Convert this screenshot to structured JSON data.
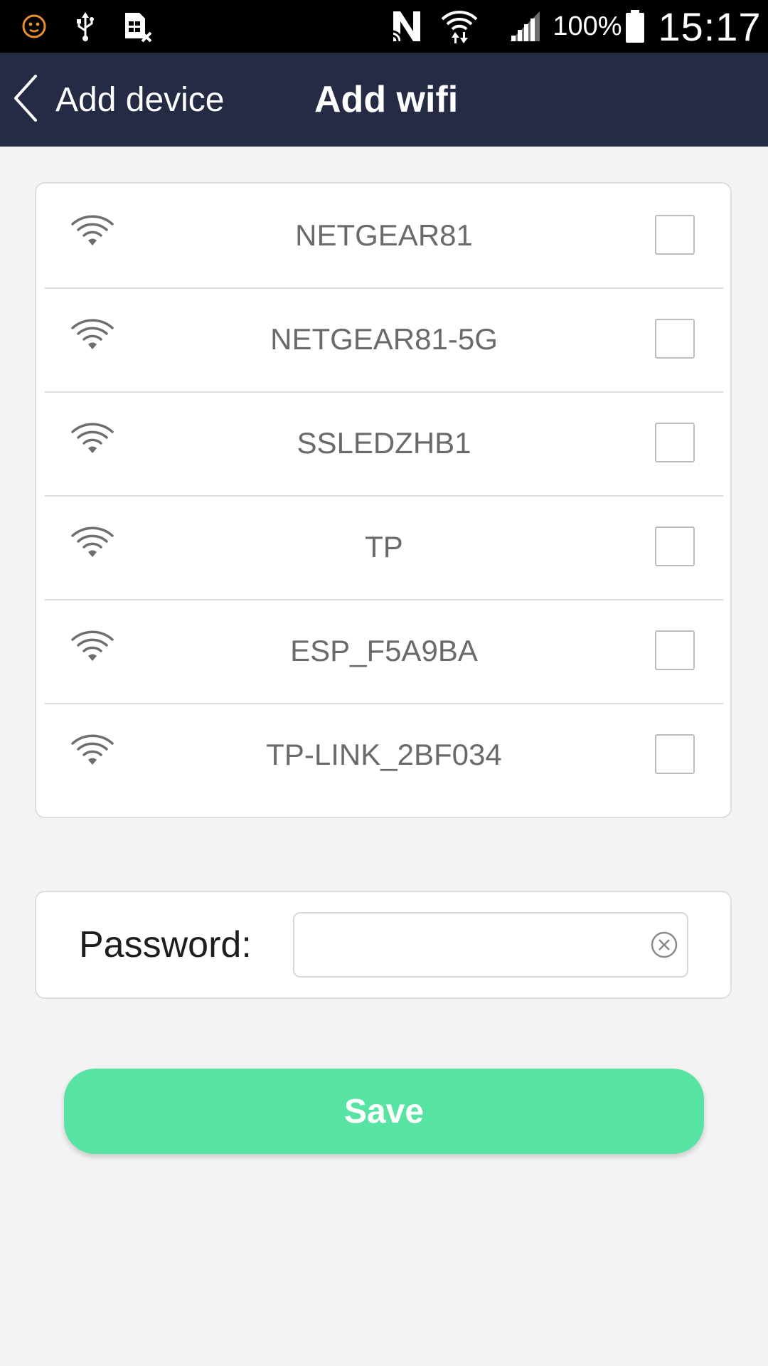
{
  "status_bar": {
    "battery_percent": "100%",
    "time": "15:17",
    "icons": [
      "android-debug-face-icon",
      "usb-icon",
      "no-sim-icon",
      "nfc-icon",
      "wifi-transfer-icon",
      "cell-signal-icon",
      "battery-icon"
    ]
  },
  "header": {
    "back_label": "Add device",
    "title": "Add wifi",
    "background_color": "#252a45"
  },
  "wifi_list": {
    "networks": [
      {
        "ssid": "NETGEAR81",
        "checked": false
      },
      {
        "ssid": "NETGEAR81-5G",
        "checked": false
      },
      {
        "ssid": "SSLEDZHB1",
        "checked": false
      },
      {
        "ssid": "TP",
        "checked": false
      },
      {
        "ssid": "ESP_F5A9BA",
        "checked": false
      },
      {
        "ssid": "TP-LINK_2BF034",
        "checked": false
      }
    ]
  },
  "password": {
    "label": "Password:",
    "value": "",
    "placeholder": ""
  },
  "save_button": {
    "label": "Save",
    "color": "#57e3a1"
  }
}
